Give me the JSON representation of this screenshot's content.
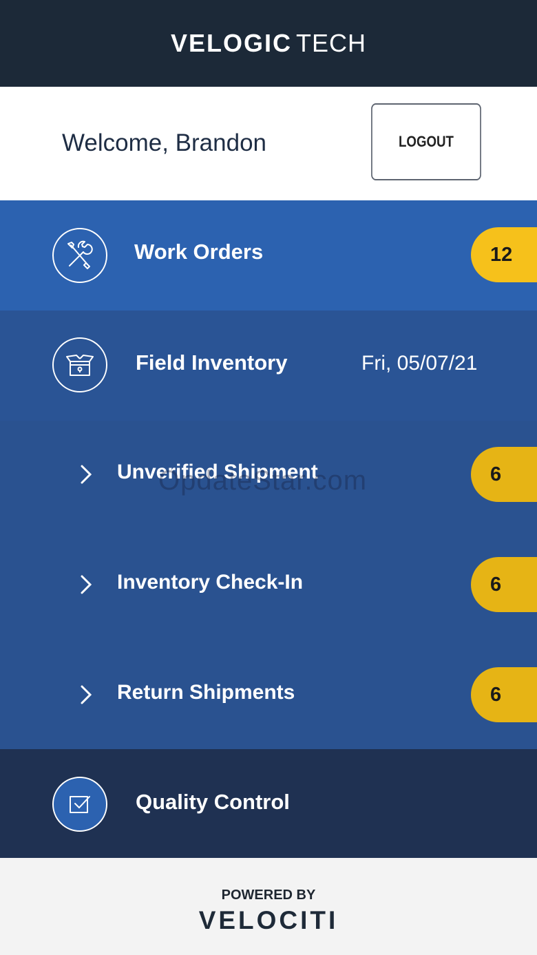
{
  "header": {
    "brand_bold": "VELOGIC",
    "brand_light": "TECH"
  },
  "welcome": {
    "text": "Welcome, Brandon",
    "logout_label": "LOGOUT"
  },
  "menu": {
    "work_orders": {
      "label": "Work Orders",
      "count": "12",
      "icon": "tools-icon"
    },
    "field_inventory": {
      "label": "Field Inventory",
      "date": "Fri, 05/07/21",
      "icon": "box-icon",
      "subitems": [
        {
          "label": "Unverified Shipment",
          "count": "6"
        },
        {
          "label": "Inventory Check-In",
          "count": "6"
        },
        {
          "label": "Return Shipments",
          "count": "6"
        }
      ]
    },
    "quality_control": {
      "label": "Quality Control",
      "icon": "checkbox-icon"
    }
  },
  "watermark": "OpdateStar.com",
  "footer": {
    "powered_by": "POWERED BY",
    "brand": "VELOCITI"
  },
  "colors": {
    "header_bg": "#1c2938",
    "work_orders_bg": "#2c62b0",
    "field_inventory_bg": "#2a5495",
    "quality_control_bg": "#1f3152",
    "badge_yellow": "#f6c11b"
  }
}
